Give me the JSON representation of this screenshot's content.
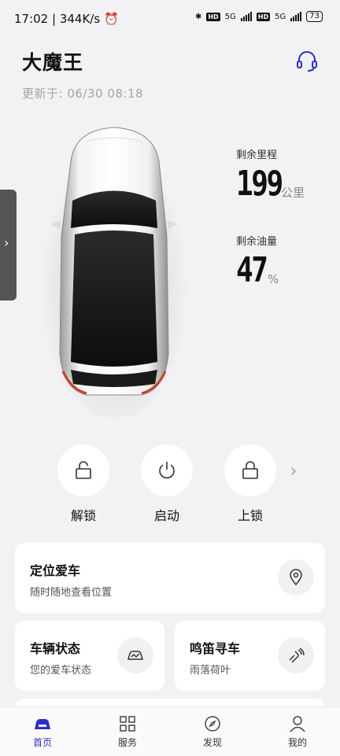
{
  "status_bar": {
    "time": "17:02",
    "speed": "344K/s",
    "network_a": "5G",
    "network_b": "5G",
    "hd": "HD",
    "battery": "73"
  },
  "header": {
    "title": "大魔王",
    "updated": "更新于: 06/30 08:18"
  },
  "stats": {
    "range_label": "剩余里程",
    "range_value": "199",
    "range_unit": "公里",
    "fuel_label": "剩余油量",
    "fuel_value": "47",
    "fuel_unit": "%"
  },
  "controls": {
    "unlock": "解锁",
    "start": "启动",
    "lock": "上锁"
  },
  "cards": {
    "locate_title": "定位爱车",
    "locate_sub": "随时随地查看位置",
    "status_title": "车辆状态",
    "status_sub": "您的爱车状态",
    "horn_title": "鸣笛寻车",
    "horn_sub": "雨落荷叶"
  },
  "tabs": {
    "home": "首页",
    "service": "服务",
    "discover": "发现",
    "mine": "我的"
  },
  "colors": {
    "accent": "#2a2ed0",
    "background": "#f2f2f4"
  }
}
